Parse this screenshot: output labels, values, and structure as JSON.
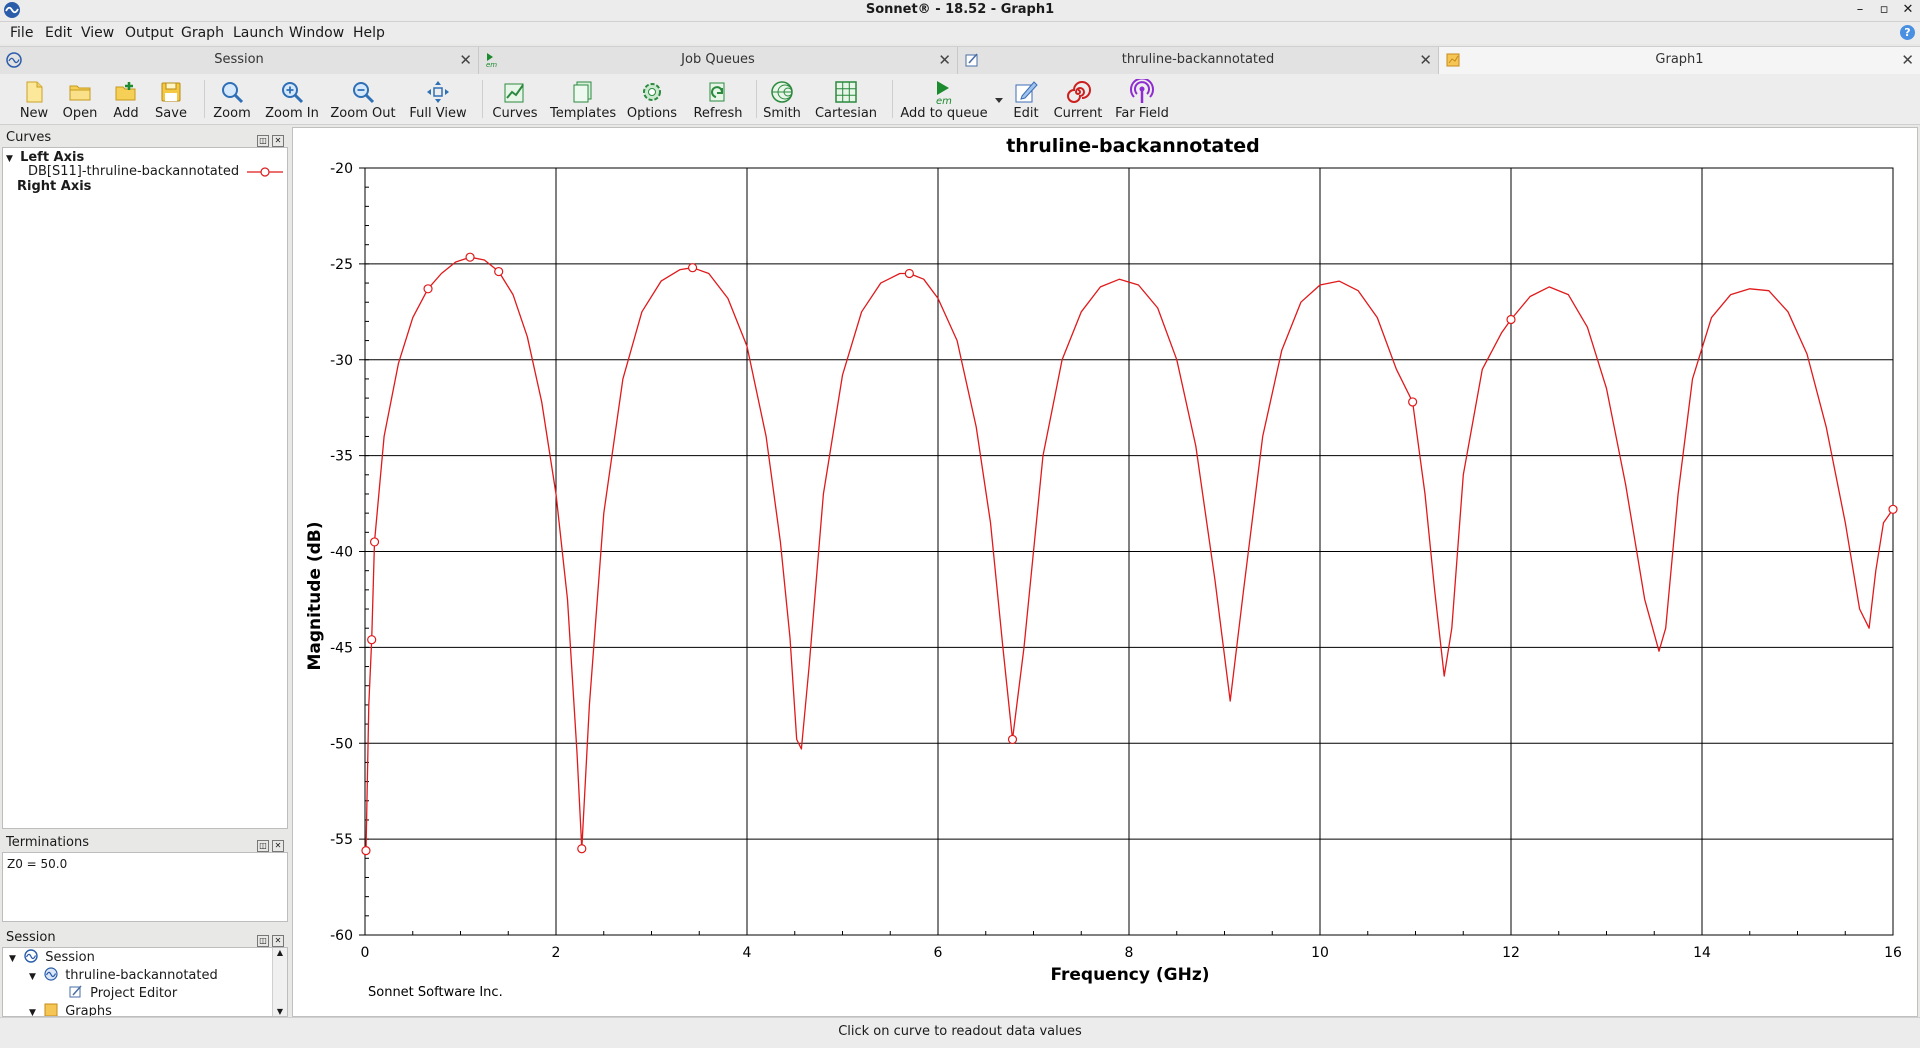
{
  "window": {
    "title": "Sonnet® - 18.52 - Graph1",
    "minimize": "–",
    "maximize": "▫",
    "close": "✕"
  },
  "menu": [
    "File",
    "Edit",
    "View",
    "Output",
    "Graph",
    "Launch",
    "Window",
    "Help"
  ],
  "tabs": [
    {
      "label": "Session",
      "close": "✕"
    },
    {
      "label": "Job Queues",
      "close": "✕"
    },
    {
      "label": "thruline-backannotated",
      "close": "✕"
    },
    {
      "label": "Graph1",
      "close": "✕"
    }
  ],
  "toolbar": {
    "new": "New",
    "open": "Open",
    "add": "Add",
    "save": "Save",
    "zoom": "Zoom",
    "zoom_in": "Zoom In",
    "zoom_out": "Zoom Out",
    "full_view": "Full View",
    "curves": "Curves",
    "templates": "Templates",
    "options": "Options",
    "refresh": "Refresh",
    "smith": "Smith",
    "cartesian": "Cartesian",
    "add_to_queue": "Add to queue",
    "edit": "Edit",
    "current": "Current",
    "far_field": "Far Field"
  },
  "curves_panel": {
    "title": "Curves",
    "left_axis": "Left Axis",
    "curve_name": "DB[S11]-thruline-backannotated",
    "right_axis": "Right Axis"
  },
  "terminations_panel": {
    "title": "Terminations",
    "value": "Z0 = 50.0"
  },
  "session_panel": {
    "title": "Session",
    "items": [
      "Session",
      "thruline-backannotated",
      "Project Editor",
      "Graphs"
    ]
  },
  "graph_footer": "Sonnet Software Inc.",
  "status": "Click on curve to readout data values",
  "colors": {
    "curve": "#e0191b",
    "grid": "#000000",
    "background": "#ffffff"
  },
  "chart_data": {
    "type": "line",
    "title": "thruline-backannotated",
    "xlabel": "Frequency (GHz)",
    "ylabel": "Magnitude (dB)",
    "xlim": [
      0,
      16
    ],
    "ylim": [
      -60,
      -20
    ],
    "xticks": [
      0,
      2,
      4,
      6,
      8,
      10,
      12,
      14,
      16
    ],
    "yticks": [
      -20,
      -25,
      -30,
      -35,
      -40,
      -45,
      -50,
      -55,
      -60
    ],
    "grid": true,
    "series": [
      {
        "name": "DB[S11]-thruline-backannotated",
        "x": [
          0.01,
          0.04,
          0.07,
          0.1,
          0.2,
          0.35,
          0.5,
          0.66,
          0.8,
          0.95,
          1.1,
          1.25,
          1.4,
          1.55,
          1.7,
          1.85,
          2.0,
          2.12,
          2.22,
          2.27,
          2.35,
          2.5,
          2.7,
          2.9,
          3.1,
          3.3,
          3.43,
          3.6,
          3.8,
          4.0,
          4.2,
          4.35,
          4.45,
          4.52,
          4.57,
          4.65,
          4.8,
          5.0,
          5.2,
          5.4,
          5.6,
          5.7,
          5.85,
          6.0,
          6.2,
          6.4,
          6.55,
          6.68,
          6.78,
          6.9,
          7.1,
          7.3,
          7.5,
          7.7,
          7.9,
          8.1,
          8.3,
          8.5,
          8.7,
          8.9,
          9.06,
          9.2,
          9.4,
          9.6,
          9.8,
          10.0,
          10.2,
          10.4,
          10.6,
          10.8,
          10.97,
          11.1,
          11.2,
          11.3,
          11.38,
          11.5,
          11.7,
          11.9,
          12.0,
          12.2,
          12.4,
          12.6,
          12.8,
          13.0,
          13.2,
          13.4,
          13.55,
          13.62,
          13.75,
          13.9,
          14.1,
          14.3,
          14.5,
          14.7,
          14.9,
          15.1,
          15.3,
          15.5,
          15.65,
          15.75,
          15.82,
          15.9,
          16.0
        ],
        "values": [
          -55.6,
          -48.0,
          -44.6,
          -39.5,
          -34.0,
          -30.2,
          -27.8,
          -26.3,
          -25.5,
          -24.9,
          -24.65,
          -24.8,
          -25.4,
          -26.6,
          -28.8,
          -32.2,
          -37.0,
          -42.5,
          -50.5,
          -55.5,
          -48.0,
          -38.0,
          -31.0,
          -27.5,
          -25.9,
          -25.3,
          -25.2,
          -25.5,
          -26.8,
          -29.3,
          -34.0,
          -39.5,
          -44.5,
          -49.8,
          -50.3,
          -46.0,
          -37.0,
          -30.8,
          -27.5,
          -26.0,
          -25.5,
          -25.5,
          -25.8,
          -26.8,
          -29.0,
          -33.5,
          -38.5,
          -45.0,
          -49.8,
          -45.0,
          -35.0,
          -30.0,
          -27.5,
          -26.2,
          -25.8,
          -26.1,
          -27.3,
          -30.0,
          -34.5,
          -41.5,
          -47.8,
          -42.0,
          -34.0,
          -29.5,
          -27.0,
          -26.1,
          -25.9,
          -26.4,
          -27.8,
          -30.5,
          -32.2,
          -37.0,
          -42.0,
          -46.5,
          -44.0,
          -36.0,
          -30.5,
          -28.6,
          -27.9,
          -26.7,
          -26.2,
          -26.6,
          -28.3,
          -31.5,
          -36.5,
          -42.5,
          -45.2,
          -44.0,
          -37.0,
          -31.0,
          -27.8,
          -26.6,
          -26.3,
          -26.4,
          -27.5,
          -29.7,
          -33.5,
          -38.5,
          -43.0,
          -44.0,
          -41.0,
          -38.5,
          -37.8
        ]
      }
    ],
    "markers": {
      "x": [
        0.01,
        0.07,
        0.1,
        0.66,
        1.1,
        1.4,
        2.27,
        3.43,
        5.7,
        6.78,
        10.97,
        12.0,
        16.0
      ],
      "y": [
        -55.6,
        -44.6,
        -39.5,
        -26.3,
        -24.65,
        -25.4,
        -55.5,
        -25.2,
        -25.5,
        -49.8,
        -32.2,
        -27.9,
        -37.8
      ]
    }
  }
}
